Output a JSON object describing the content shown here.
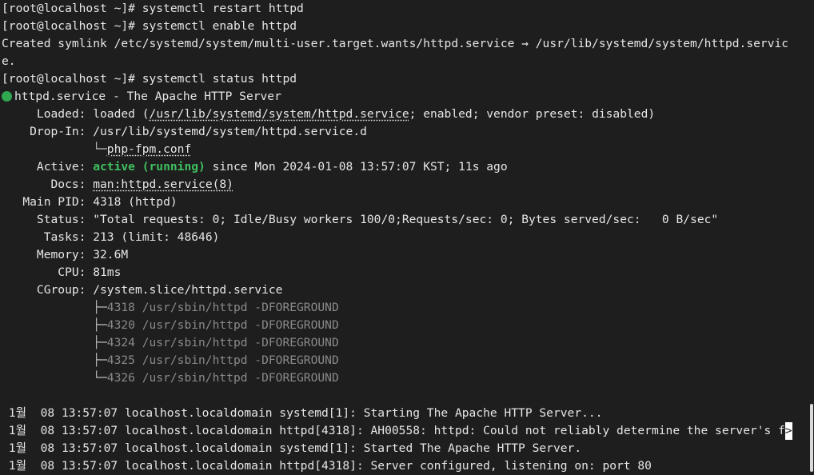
{
  "terminal": {
    "cmd1": "[root@localhost ~]# systemctl restart httpd",
    "cmd2": "[root@localhost ~]# systemctl enable httpd",
    "symlink_line1": "Created symlink /etc/systemd/system/multi-user.target.wants/httpd.service → /usr/lib/systemd/system/httpd.servic",
    "symlink_line2": "e.",
    "cmd3": "[root@localhost ~]# systemctl status httpd",
    "status_icon": "green-dot",
    "unit_title": "httpd.service - The Apache HTTP Server",
    "loaded_key": "     Loaded: ",
    "loaded_pre": "loaded (",
    "loaded_path": "/usr/lib/systemd/system/httpd.service",
    "loaded_post": "; enabled; vendor preset: disabled)",
    "dropin_key": "    Drop-In: ",
    "dropin_value": "/usr/lib/systemd/system/httpd.service.d",
    "dropin_tree": "             └─",
    "dropin_file": "php-fpm.conf",
    "active_key": "     Active: ",
    "active_state": "active (running)",
    "active_since": " since Mon 2024-01-08 13:57:07 KST; 11s ago",
    "docs_key": "       Docs: ",
    "docs_value": "man:httpd.service(8)",
    "mainpid_key": "   Main PID: ",
    "mainpid_value": "4318 (httpd)",
    "status_key": "     Status: ",
    "status_value": "\"Total requests: 0; Idle/Busy workers 100/0;Requests/sec: 0; Bytes served/sec:   0 B/sec\"",
    "tasks_key": "      Tasks: ",
    "tasks_value": "213 (limit: 48646)",
    "memory_key": "     Memory: ",
    "memory_value": "32.6M",
    "cpu_key": "        CPU: ",
    "cpu_value": "81ms",
    "cgroup_key": "     CGroup: ",
    "cgroup_value": "/system.slice/httpd.service",
    "cgroup_procs": [
      {
        "branch": "             ├─",
        "text": "4318 /usr/sbin/httpd -DFOREGROUND"
      },
      {
        "branch": "             ├─",
        "text": "4320 /usr/sbin/httpd -DFOREGROUND"
      },
      {
        "branch": "             ├─",
        "text": "4324 /usr/sbin/httpd -DFOREGROUND"
      },
      {
        "branch": "             ├─",
        "text": "4325 /usr/sbin/httpd -DFOREGROUND"
      },
      {
        "branch": "             └─",
        "text": "4326 /usr/sbin/httpd -DFOREGROUND"
      }
    ],
    "log_lines": [
      " 1월  08 13:57:07 localhost.localdomain systemd[1]: Starting The Apache HTTP Server...",
      " 1월  08 13:57:07 localhost.localdomain httpd[4318]: AH00558: httpd: Could not reliably determine the server's f",
      " 1월  08 13:57:07 localhost.localdomain systemd[1]: Started The Apache HTTP Server.",
      " 1월  08 13:57:07 localhost.localdomain httpd[4318]: Server configured, listening on: port 80"
    ],
    "cursor_char": ">"
  },
  "colors": {
    "background": "#1e1e1e",
    "text": "#e6e6e6",
    "active_green": "#3fbf5f",
    "dim_gray": "#8a8a8a"
  }
}
